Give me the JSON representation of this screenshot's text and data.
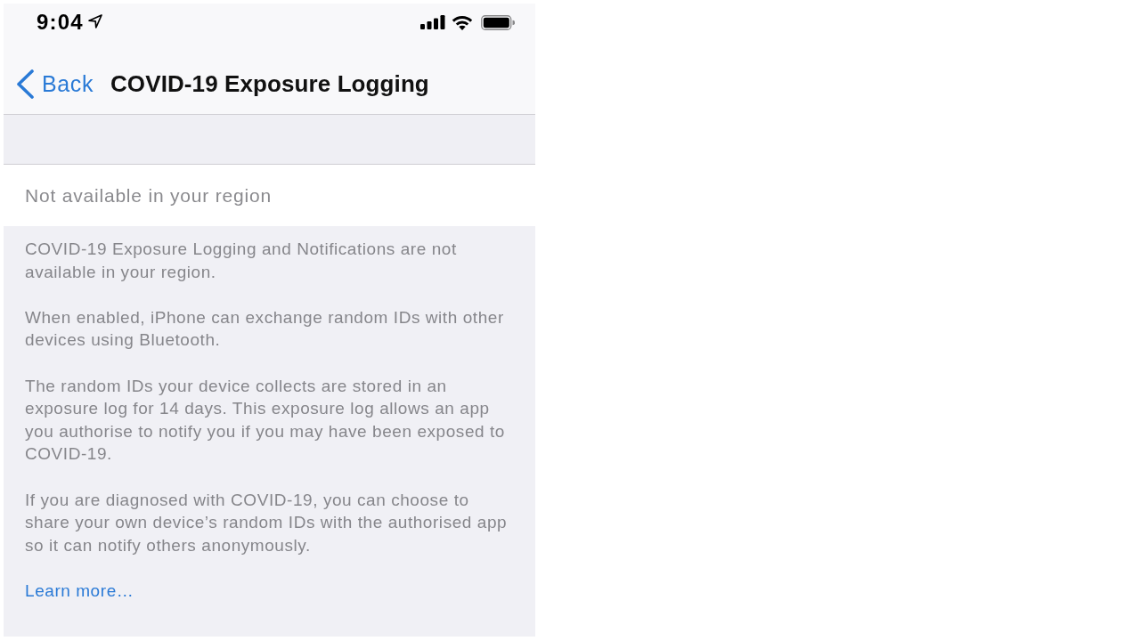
{
  "status_bar": {
    "time": "9:04"
  },
  "nav_bar": {
    "back_label": "Back",
    "title": "COVID-19 Exposure Logging"
  },
  "status_cell": {
    "text": "Not available in your region",
    "disabled": true
  },
  "footer": {
    "paragraphs": [
      "COVID-19 Exposure Logging and Notifications are not available in your region.",
      "When enabled, iPhone can exchange random IDs with other devices using Bluetooth.",
      "The random IDs your device collects are stored in an exposure log for 14 days. This exposure log allows an app you authorise to notify you if you may have been exposed to COVID-19.",
      "If you are diagnosed with COVID-19, you can choose to share your own device’s random IDs with the authorised app so it can notify others anonymously."
    ],
    "link": "Learn more…"
  }
}
